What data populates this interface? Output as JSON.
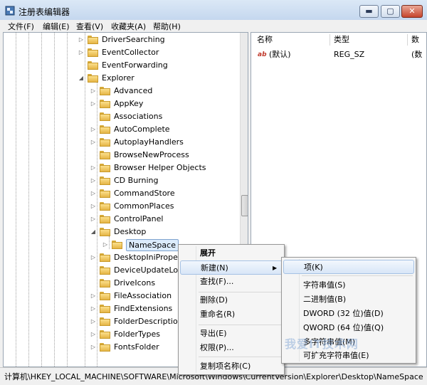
{
  "window": {
    "title": "注册表编辑器",
    "controls": {
      "minimize": "▬",
      "maximize": "▢",
      "close": "✕"
    }
  },
  "menubar": [
    "文件(F)",
    "编辑(E)",
    "查看(V)",
    "收藏夹(A)",
    "帮助(H)"
  ],
  "tree": [
    {
      "label": "DriverSearching",
      "level": 0,
      "expander": "collapsed"
    },
    {
      "label": "EventCollector",
      "level": 0,
      "expander": "collapsed"
    },
    {
      "label": "EventForwarding",
      "level": 0,
      "expander": "none"
    },
    {
      "label": "Explorer",
      "level": 0,
      "expander": "expanded"
    },
    {
      "label": "Advanced",
      "level": 1,
      "expander": "collapsed"
    },
    {
      "label": "AppKey",
      "level": 1,
      "expander": "collapsed"
    },
    {
      "label": "Associations",
      "level": 1,
      "expander": "none"
    },
    {
      "label": "AutoComplete",
      "level": 1,
      "expander": "collapsed"
    },
    {
      "label": "AutoplayHandlers",
      "level": 1,
      "expander": "collapsed"
    },
    {
      "label": "BrowseNewProcess",
      "level": 1,
      "expander": "none"
    },
    {
      "label": "Browser Helper Objects",
      "level": 1,
      "expander": "collapsed"
    },
    {
      "label": "CD Burning",
      "level": 1,
      "expander": "collapsed"
    },
    {
      "label": "CommandStore",
      "level": 1,
      "expander": "collapsed"
    },
    {
      "label": "CommonPlaces",
      "level": 1,
      "expander": "collapsed"
    },
    {
      "label": "ControlPanel",
      "level": 1,
      "expander": "collapsed"
    },
    {
      "label": "Desktop",
      "level": 1,
      "expander": "expanded"
    },
    {
      "label": "NameSpace",
      "level": 2,
      "expander": "collapsed",
      "selected": true
    },
    {
      "label": "DesktopIniProper",
      "level": 1,
      "expander": "collapsed"
    },
    {
      "label": "DeviceUpdateLoc",
      "level": 1,
      "expander": "none"
    },
    {
      "label": "DriveIcons",
      "level": 1,
      "expander": "none"
    },
    {
      "label": "FileAssociation",
      "level": 1,
      "expander": "collapsed"
    },
    {
      "label": "FindExtensions",
      "level": 1,
      "expander": "collapsed"
    },
    {
      "label": "FolderDescription",
      "level": 1,
      "expander": "collapsed"
    },
    {
      "label": "FolderTypes",
      "level": 1,
      "expander": "collapsed"
    },
    {
      "label": "FontsFolder",
      "level": 1,
      "expander": "collapsed"
    }
  ],
  "values_pane": {
    "columns": {
      "name": "名称",
      "type": "类型",
      "data": "数"
    },
    "rows": [
      {
        "name": "(默认)",
        "type": "REG_SZ",
        "data": "(数"
      }
    ]
  },
  "context_menu": {
    "items": [
      "展开",
      "新建(N)",
      "查找(F)...",
      "删除(D)",
      "重命名(R)",
      "导出(E)",
      "权限(P)...",
      "复制项名称(C)"
    ]
  },
  "submenu": {
    "items": [
      "项(K)",
      "字符串值(S)",
      "二进制值(B)",
      "DWORD (32 位)值(D)",
      "QWORD (64 位)值(Q)",
      "多字符串值(M)",
      "可扩充字符串值(E)"
    ]
  },
  "statusbar": {
    "path": "计算机\\HKEY_LOCAL_MACHINE\\SOFTWARE\\Microsoft\\Windows\\CurrentVersion\\Explorer\\Desktop\\NameSpace"
  },
  "watermark": "我爱IT技术网"
}
